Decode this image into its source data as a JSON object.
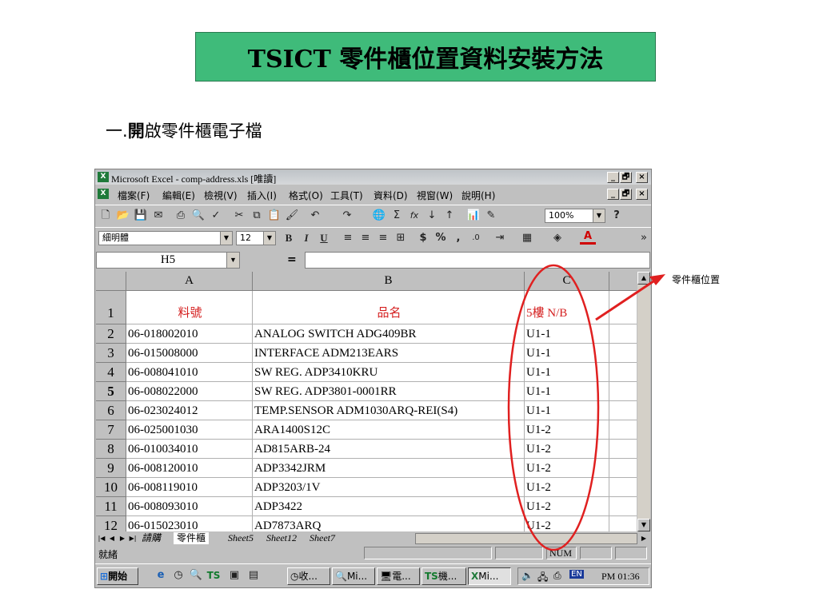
{
  "slide": {
    "title": "TSICT 零件櫃位置資料安裝方法",
    "step_num": "一.",
    "step_bold": "開",
    "step_rest": "啟零件櫃電子檔",
    "annotation": "零件櫃位置",
    "annotation_color": "#e02020"
  },
  "window": {
    "title": "Microsoft Excel - comp-address.xls [唯讀]",
    "title_icon": "X",
    "min_label": "_",
    "max_label": "🗗",
    "close_label": "×"
  },
  "menu": {
    "items": [
      "檔案(F)",
      "編輯(E)",
      "檢視(V)",
      "插入(I)",
      "格式(O)",
      "工具(T)",
      "資料(D)",
      "視窗(W)",
      "說明(H)"
    ]
  },
  "toolbar": {
    "zoom": "100%",
    "font_name": "細明體",
    "font_size": "12",
    "bold": "B",
    "italic": "I",
    "underline": "U",
    "sigma": "Σ",
    "fx": "fx",
    "dollar": "$",
    "percent": "%",
    "comma": ",",
    "font_color": "A",
    "help": "?"
  },
  "formula_bar": {
    "name_box": "H5",
    "equals": "="
  },
  "sheet": {
    "columns": [
      "A",
      "B",
      "C",
      ""
    ],
    "header_row": {
      "num": "1",
      "a": "料號",
      "b": "品名",
      "c": "5樓 N/B"
    },
    "rows": [
      {
        "num": "2",
        "a": "06-018002010",
        "b": "ANALOG SWITCH ADG409BR",
        "c": "U1-1"
      },
      {
        "num": "3",
        "a": "06-015008000",
        "b": "INTERFACE ADM213EARS",
        "c": "U1-1"
      },
      {
        "num": "4",
        "a": "06-008041010",
        "b": "SW REG. ADP3410KRU",
        "c": "U1-1"
      },
      {
        "num": "5",
        "a": "06-008022000",
        "b": "SW REG. ADP3801-0001RR",
        "c": "U1-1"
      },
      {
        "num": "6",
        "a": "06-023024012",
        "b": "TEMP.SENSOR ADM1030ARQ-REI(S4)",
        "c": "U1-1"
      },
      {
        "num": "7",
        "a": "06-025001030",
        "b": "ARA1400S12C",
        "c": "U1-2"
      },
      {
        "num": "8",
        "a": "06-010034010",
        "b": "AD815ARB-24",
        "c": "U1-2"
      },
      {
        "num": "9",
        "a": "06-008120010",
        "b": "ADP3342JRM",
        "c": "U1-2"
      },
      {
        "num": "10",
        "a": "06-008119010",
        "b": "ADP3203/1V",
        "c": "U1-2"
      },
      {
        "num": "11",
        "a": "06-008093010",
        "b": "ADP3422",
        "c": "U1-2"
      },
      {
        "num": "12",
        "a": "06-015023010",
        "b": "AD7873ARQ",
        "c": "U1-2"
      }
    ],
    "tabs": [
      "請購",
      "零件櫃",
      "Sheet5",
      "Sheet12",
      "Sheet7"
    ]
  },
  "status": {
    "ready": "就緒",
    "num": "NUM"
  },
  "taskbar": {
    "start": "開始",
    "tasks": [
      "收...",
      "Mi...",
      "電...",
      "機...",
      "Mi..."
    ],
    "clock": "PM 01:36",
    "lang": "EN"
  }
}
